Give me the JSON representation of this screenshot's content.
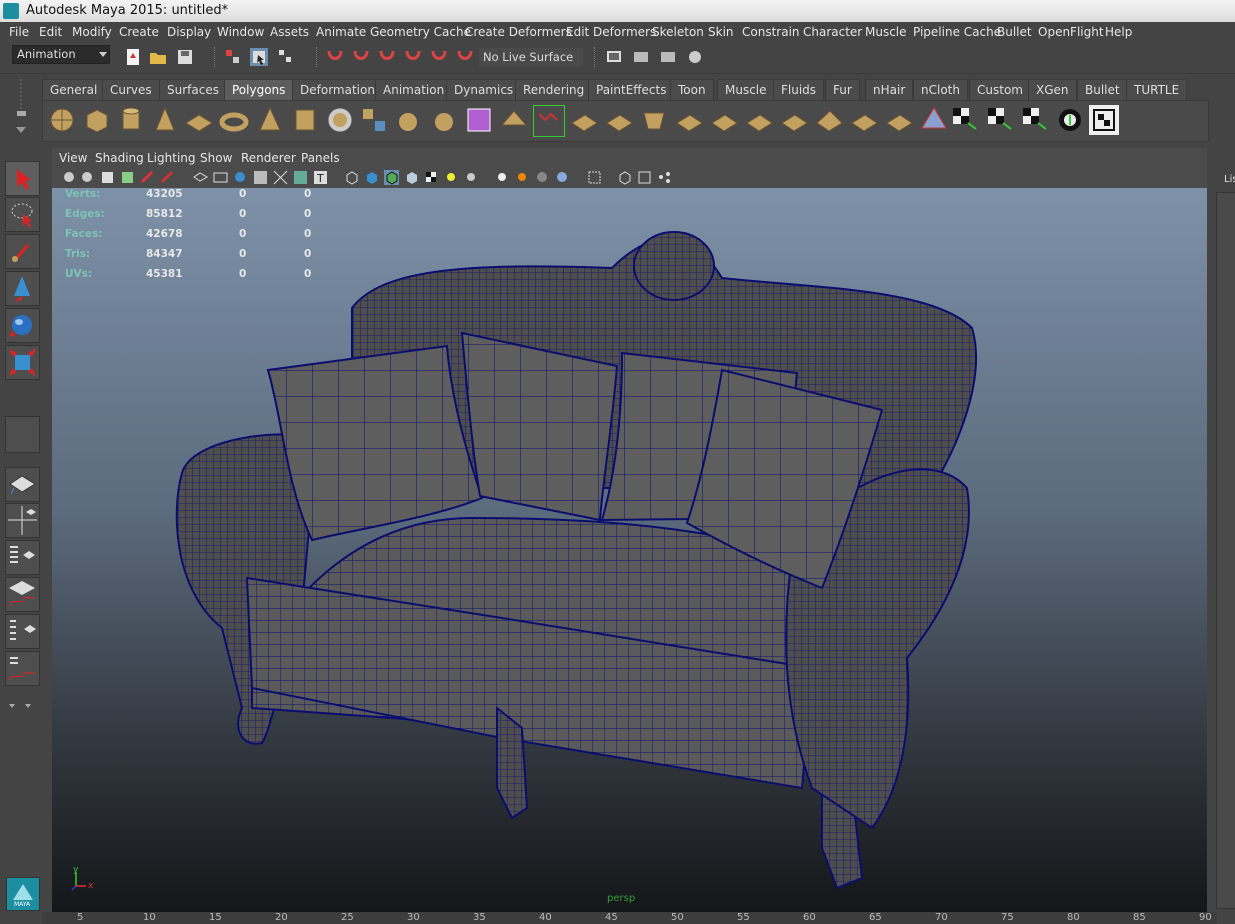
{
  "window": {
    "title": "Autodesk Maya 2015: untitled*"
  },
  "menu": [
    "File",
    "Edit",
    "Modify",
    "Create",
    "Display",
    "Window",
    "Assets",
    "Animate",
    "Geometry Cache",
    "Create Deformers",
    "Edit Deformers",
    "Skeleton",
    "Skin",
    "Constrain",
    "Character",
    "Muscle",
    "Pipeline Cache",
    "Bullet",
    "OpenFlight",
    "Help"
  ],
  "status_line": {
    "mode": "Animation",
    "live_surface": "No Live Surface"
  },
  "shelf_tabs": [
    "General",
    "Curves",
    "Surfaces",
    "Polygons",
    "Deformation",
    "Animation",
    "Dynamics",
    "Rendering",
    "PaintEffects",
    "Toon",
    "Muscle",
    "Fluids",
    "Fur",
    "nHair",
    "nCloth",
    "Custom",
    "XGen",
    "Bullet",
    "TURTLE"
  ],
  "active_shelf_tab": "Polygons",
  "panel_menu": [
    "View",
    "Shading",
    "Lighting",
    "Show",
    "Renderer",
    "Panels"
  ],
  "hud": {
    "rows": [
      {
        "label": "Verts:",
        "total": "43205",
        "sel": "0",
        "uv": "0"
      },
      {
        "label": "Edges:",
        "total": "85812",
        "sel": "0",
        "uv": "0"
      },
      {
        "label": "Faces:",
        "total": "42678",
        "sel": "0",
        "uv": "0"
      },
      {
        "label": "Tris:",
        "total": "84347",
        "sel": "0",
        "uv": "0"
      },
      {
        "label": "UVs:",
        "total": "45381",
        "sel": "0",
        "uv": "0"
      }
    ]
  },
  "viewport": {
    "camera_label": "persp",
    "axis_y": "y",
    "axis_x": "x"
  },
  "right_panel_label": "Lis",
  "ruler_ticks": [
    "5",
    "10",
    "15",
    "20",
    "25",
    "30",
    "35",
    "40",
    "45",
    "50",
    "55",
    "60",
    "65",
    "70",
    "75",
    "80",
    "85",
    "90"
  ],
  "maya_logo_text": "MAYA",
  "colors": {
    "wire": "#0b0d6e",
    "mesh": "#5a5a5a",
    "hud_label": "#7ec4b6"
  }
}
